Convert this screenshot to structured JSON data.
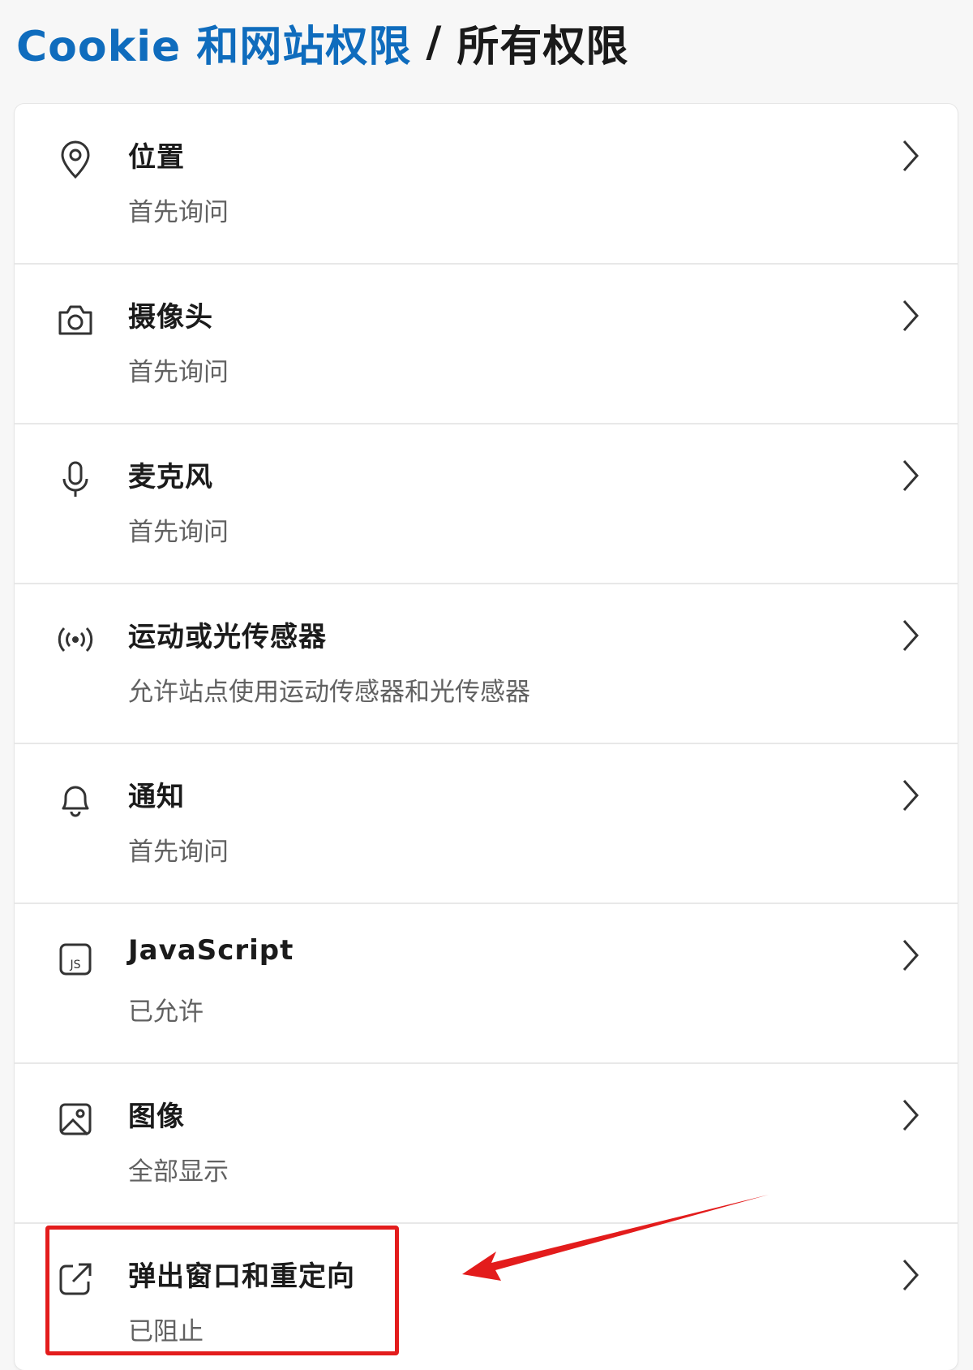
{
  "breadcrumb": {
    "parent": "Cookie 和网站权限",
    "separator": "/",
    "current": "所有权限"
  },
  "permissions": [
    {
      "icon": "location-pin-icon",
      "title": "位置",
      "status": "首先询问"
    },
    {
      "icon": "camera-icon",
      "title": "摄像头",
      "status": "首先询问"
    },
    {
      "icon": "microphone-icon",
      "title": "麦克风",
      "status": "首先询问"
    },
    {
      "icon": "sensor-icon",
      "title": "运动或光传感器",
      "status": "允许站点使用运动传感器和光传感器"
    },
    {
      "icon": "bell-icon",
      "title": "通知",
      "status": "首先询问"
    },
    {
      "icon": "javascript-icon",
      "title": "JavaScript",
      "status": "已允许"
    },
    {
      "icon": "image-icon",
      "title": "图像",
      "status": "全部显示"
    },
    {
      "icon": "open-external-icon",
      "title": "弹出窗口和重定向",
      "status": "已阻止"
    }
  ],
  "annotation": {
    "highlight_color": "#e31c1c",
    "highlighted_item": "弹出窗口和重定向"
  },
  "colors": {
    "link": "#0f6cbd",
    "title": "#1b1b1b",
    "subtitle": "#616161",
    "background": "#f7f7f7"
  }
}
